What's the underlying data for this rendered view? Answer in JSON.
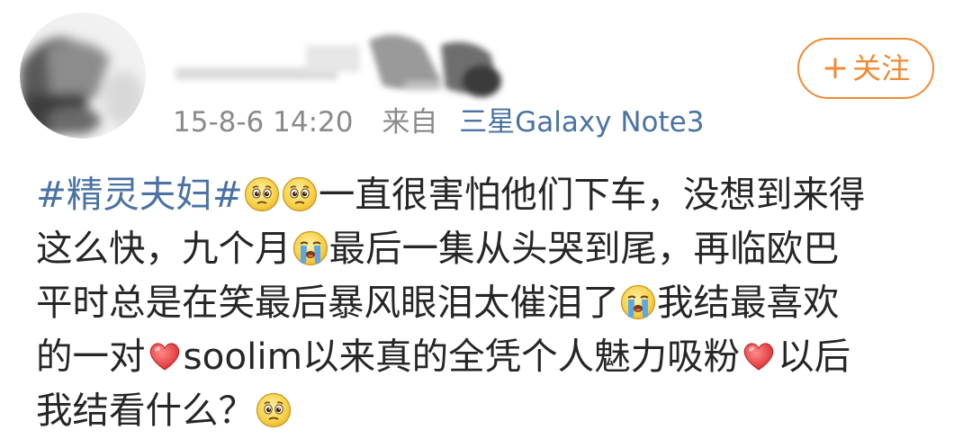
{
  "post": {
    "author": {
      "avatar_icon": "avatar-blurred",
      "name": ""
    },
    "meta": {
      "time": "15-8-6 14:20",
      "source_prefix": "来自",
      "device": "三星Galaxy Note3"
    },
    "follow_button": {
      "icon": "plus-icon",
      "plus": "+",
      "label": "关注",
      "color": "#f08a34"
    },
    "content": {
      "hashtag": "#精灵夫妇#",
      "line1_text": "一直很害怕他们下车，没想到来得",
      "line2_a": "这么快，九个月",
      "line2_b": "最后一集从头哭到尾，再临欧巴",
      "line3_a": "平时总是在笑最后暴风眼泪太催泪了",
      "line3_b": "我结最喜欢",
      "line4_a": "的一对",
      "line4_b": "soolim以来真的全凭个人魅力吸粉",
      "line4_c": "以后",
      "line5_a": "我结看什么？",
      "link_color": "#4a72a3"
    },
    "emoji_names": [
      "pitiful-face-emoji",
      "pitiful-face-emoji",
      "crying-face-emoji",
      "crying-face-emoji",
      "red-heart-emoji",
      "red-heart-emoji",
      "pitiful-face-emoji"
    ]
  }
}
